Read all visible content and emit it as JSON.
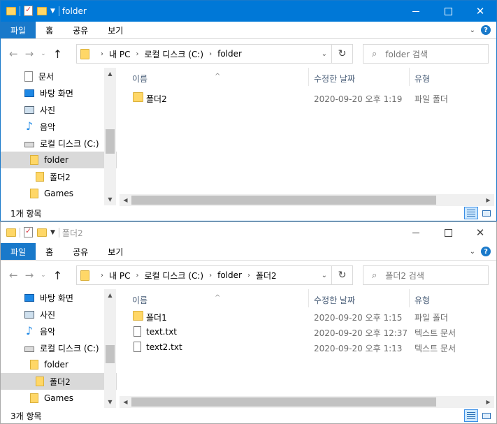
{
  "windows": [
    {
      "title": "folder",
      "ribbon_tabs": [
        "파일",
        "홈",
        "공유",
        "보기"
      ],
      "breadcrumb": [
        "내 PC",
        "로컬 디스크 (C:)",
        "folder"
      ],
      "search_placeholder": "folder 검색",
      "nav_items": [
        "문서",
        "바탕 화면",
        "사진",
        "음악",
        "로컬 디스크 (C:)",
        "folder",
        "폴더2",
        "Games"
      ],
      "columns": [
        "이름",
        "수정한 날짜",
        "유형"
      ],
      "rows": [
        {
          "name": "폴더2",
          "date": "2020-09-20 오후 1:19",
          "type": "파일 폴더",
          "icon": "folder-icon"
        }
      ],
      "status": "1개 항목"
    },
    {
      "title": "폴더2",
      "ribbon_tabs": [
        "파일",
        "홈",
        "공유",
        "보기"
      ],
      "breadcrumb": [
        "내 PC",
        "로컬 디스크 (C:)",
        "folder",
        "폴더2"
      ],
      "search_placeholder": "폴더2 검색",
      "nav_items": [
        "바탕 화면",
        "사진",
        "음악",
        "로컬 디스크 (C:)",
        "folder",
        "폴더2",
        "Games"
      ],
      "columns": [
        "이름",
        "수정한 날짜",
        "유형"
      ],
      "rows": [
        {
          "name": "폴더1",
          "date": "2020-09-20 오후 1:15",
          "type": "파일 폴더",
          "icon": "folder-icon"
        },
        {
          "name": "text.txt",
          "date": "2020-09-20 오후 12:37",
          "type": "텍스트 문서",
          "icon": "text-file-icon"
        },
        {
          "name": "text2.txt",
          "date": "2020-09-20 오후 1:13",
          "type": "텍스트 문서",
          "icon": "text-file-icon"
        }
      ],
      "status": "3개 항목"
    }
  ],
  "colors": {
    "accent": "#0078d7",
    "file_tab": "#1979ca",
    "selection": "#cce8ff",
    "folder": "#ffd767"
  }
}
